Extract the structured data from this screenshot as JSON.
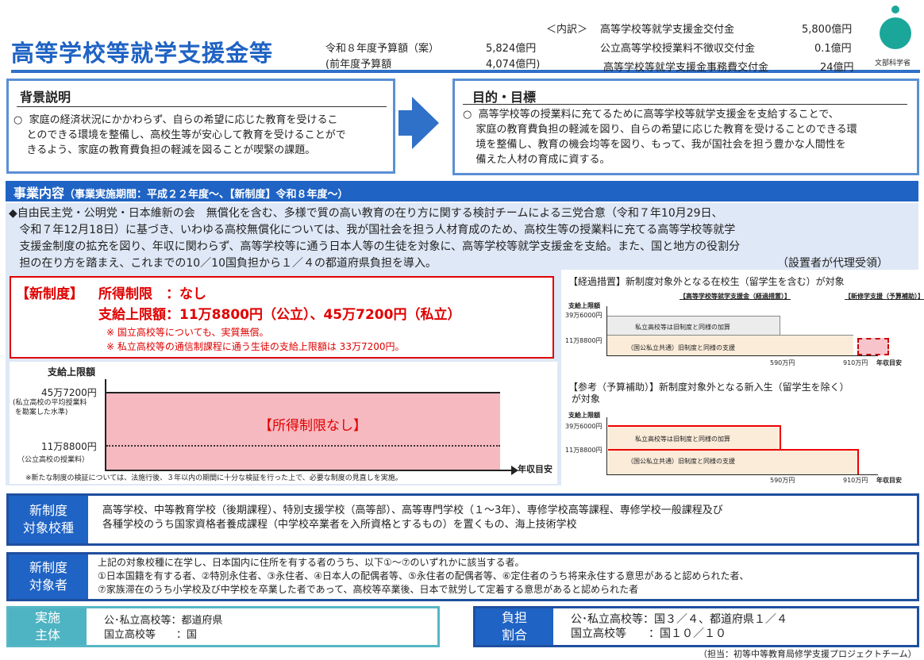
{
  "header": {
    "title": "高等学校等就学支援金等",
    "budget_label": "令和８年度予算額（案）",
    "budget_value": "5,824億円",
    "prev_label": "(前年度予算額",
    "prev_value": "4,074億円)",
    "breakdown_label": "＜内訳＞",
    "breakdown": [
      {
        "label": "高等学校等就学支援金交付金",
        "value": "5,800億円"
      },
      {
        "label": "公立高等学校授業料不徴収交付金",
        "value": "0.1億円"
      },
      {
        "label": "高等学校等就学支援金事務費交付金",
        "value": "24億円"
      }
    ],
    "ministry": "文部科学省"
  },
  "background": {
    "title": "背景説明",
    "body": "○  家庭の経済状況にかかわらず、自らの希望に応じた教育を受けるこ\n    とのできる環境を整備し、高校生等が安心して教育を受けることがで\n    きるよう、家庭の教育費負担の軽減を図ることが喫緊の課題。"
  },
  "purpose": {
    "title": "目的・目標",
    "body": "○  高等学校等の授業料に充てるために高等学校等就学支援金を支給することで、\n    家庭の教育費負担の軽減を図り、自らの希望に応じた教育を受けることのできる環\n    境を整備し、教育の機会均等を図り、もって、我が国社会を担う豊かな人間性を\n    備えた人材の育成に資する。"
  },
  "business": {
    "title": "事業内容",
    "period": "（事業実施期間：平成２２年度～、【新制度】令和８年度～）",
    "body": "◆自由民主党・公明党・日本維新の会　無償化を含む、多様で質の高い教育の在り方に関する検討チームによる三党合意（令和７年10月29日、\n   令和７年12月18日）に基づき、いわゆる高校無償化については、我が国社会を担う人材育成のため、高校生等の授業料に充てる高等学校等就学\n   支援金制度の拡充を図り、年収に関わらず、高等学校等に通う日本人等の生徒を対象に、高等学校等就学支援金を支給。また、国と地方の役割分\n   担の在り方を踏まえ、これまでの10／10国負担から１／４の都道府県負担を導入。",
    "note_right": "（設置者が代理受領）"
  },
  "new_system": {
    "tag": "【新制度】",
    "income_limit": "所得制限　：なし",
    "cap": "支給上限額：11万8800円（公立）、45万7200円（私立）",
    "note1": "※ 国立高校等についても、実質無償。",
    "note2": "※ 私立高校等の通信制課程に通う生徒の支給上限額は 33万7200円。"
  },
  "main_chart": {
    "ylabel": "支給上限額",
    "upper_label": "45万7200円",
    "upper_sub": "(私立高校の平均授業料\n を勘案した水準)",
    "lower_label": "11万8800円",
    "lower_sub": "（公立高校の授業料）",
    "region_label": "【所得制限なし】",
    "xlabel": "年収目安",
    "footnote": "※新たな制度の検証については、法施行後、３年以内の期間に十分な検証を行った上で、必要な制度の見直しを実施。"
  },
  "chart_data": [
    {
      "type": "area",
      "title": "",
      "ylabel": "支給上限額",
      "xlabel": "年収目安",
      "series": [
        {
          "name": "【所得制限なし】",
          "values": [
            457200,
            457200
          ]
        }
      ],
      "reference_lines": [
        457200,
        118800
      ]
    }
  ],
  "transition": {
    "title": "【経過措置】新制度対象外となる在校生（留学生を含む）が対象",
    "ylabel": "支給上限額",
    "tag_left": "【高等学校等就学支援金（経過措置）】",
    "tag_right": "【新修学支援（予算補助）】",
    "y_upper": "39万6000円",
    "y_lower": "11万8800円",
    "band_upper": "私立高校等は旧制度と同様の加算",
    "band_lower": "（国公私立共通）旧制度と同様の支援",
    "x1": "590万円",
    "x2": "910万円",
    "xlabel": "年収目安"
  },
  "reference": {
    "title": "【参考（予算補助）】新制度対象外となる新入生（留学生を除く）\n が対象",
    "ylabel": "支給上限額",
    "y_upper": "39万6000円",
    "y_lower": "11万8800円",
    "band_upper": "私立高校等は旧制度と同様の加算",
    "band_lower": "（国公私立共通）旧制度と同様の支援",
    "x1": "590万円",
    "x2": "910万円",
    "xlabel": "年収目安"
  },
  "eligible_schools": {
    "label": "新制度\n対象校種",
    "body": "高等学校、中等教育学校（後期課程）、特別支援学校（高等部）、高等専門学校（１～3年）、専修学校高等課程、専修学校一般課程及び\n各種学校のうち国家資格者養成課程（中学校卒業者を入所資格とするもの）を置くもの、海上技術学校"
  },
  "eligible_persons": {
    "label": "新制度\n対象者",
    "body": "上記の対象校種に在学し、日本国内に住所を有する者のうち、以下①～⑦のいずれかに該当する者。\n①日本国籍を有する者、②特別永住者、③永住者、④日本人の配偶者等、⑤永住者の配偶者等、⑥定住者のうち将来永住する意思があると認められた者、\n⑦家族滞在のうち小学校及び中学校を卒業した者であって、高校等卒業後、日本で就労して定着する意思があると認められた者"
  },
  "implementer": {
    "label": "実施\n主体",
    "body": "公･私立高校等：都道府県\n国立高校等　　：国"
  },
  "burden": {
    "label": "負担\n割合",
    "body": "公･私立高校等：国３／４、都道府県１／４\n国立高校等　　：国１０／１０"
  },
  "footer": "（担当：初等中等教育局修学支援プロジェクトチーム）",
  "colors": {
    "accent": "#1f63c4",
    "red": "#e00000",
    "pink": "#f7b9c0",
    "teal": "#4eb3c2"
  }
}
